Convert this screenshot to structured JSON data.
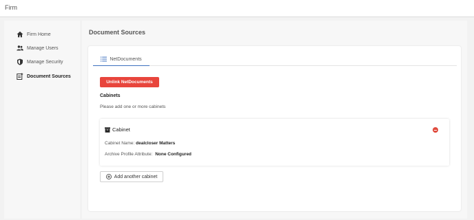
{
  "app": {
    "title": "Firm"
  },
  "sidebar": {
    "items": [
      {
        "label": "Firm Home",
        "icon": "home-icon"
      },
      {
        "label": "Manage Users",
        "icon": "users-icon"
      },
      {
        "label": "Manage Security",
        "icon": "shield-icon"
      },
      {
        "label": "Document Sources",
        "icon": "document-source-icon",
        "active": true
      }
    ]
  },
  "main": {
    "page_title": "Document Sources",
    "tabs": [
      {
        "label": "NetDocuments",
        "icon": "list-icon",
        "active": true
      }
    ],
    "unlink_button": "Unlink NetDocuments",
    "cabinets_label": "Cabinets",
    "hint": "Please add one or more cabinets",
    "cabinet": {
      "title": "Cabinet",
      "name_label": "Cabinet Name:",
      "name_value": "dealcloser Matters",
      "attr_label": "Archive Profile Attribute:",
      "attr_value": "None Configured"
    },
    "add_button": "Add another cabinet"
  },
  "colors": {
    "accent": "#3c6fbf",
    "danger": "#e8453c",
    "background": "#f2f2f2"
  }
}
